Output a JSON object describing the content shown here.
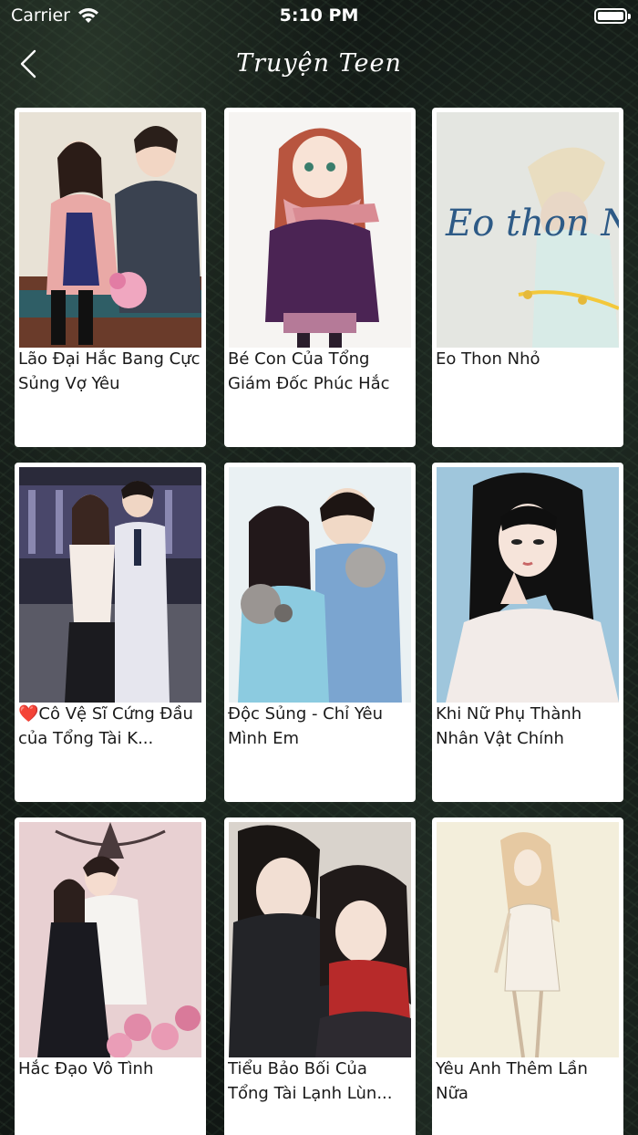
{
  "status_bar": {
    "carrier": "Carrier",
    "time": "5:10 PM"
  },
  "nav": {
    "title": "Truyện Teen",
    "back_icon": "chevron-left-icon"
  },
  "stories": [
    {
      "title": "Lão Đại Hắc Bang Cực Sủng Vợ Yêu"
    },
    {
      "title": "Bé Con Của Tổng Giám Đốc Phúc Hắc"
    },
    {
      "title": "Eo Thon Nhỏ",
      "cover_text": "Eo thon Nhỏ"
    },
    {
      "title": "❤️Cô Vệ Sĩ Cứng Đầu của Tổng Tài K..."
    },
    {
      "title": "Độc Sủng - Chỉ Yêu Mình Em"
    },
    {
      "title": "Khi Nữ Phụ Thành Nhân Vật Chính"
    },
    {
      "title": "Hắc Đạo Vô Tình"
    },
    {
      "title": "Tiểu Bảo Bối Của Tổng Tài Lạnh Lùn..."
    },
    {
      "title": "Yêu Anh Thêm Lần Nữa"
    }
  ]
}
